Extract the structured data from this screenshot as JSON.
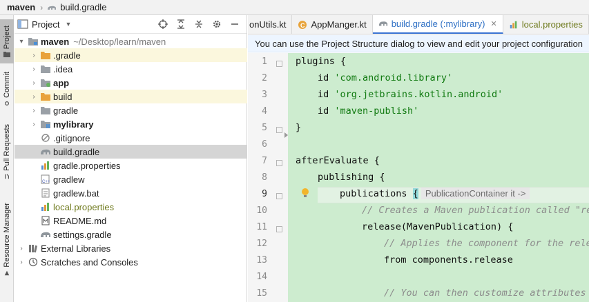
{
  "breadcrumb": {
    "root": "maven",
    "file": "build.gradle"
  },
  "tool_strip": {
    "project": "Project",
    "commit": "Commit",
    "pull_requests": "Pull Requests",
    "resource_manager": "Resource Manager"
  },
  "project_panel": {
    "title": "Project",
    "tree": [
      {
        "label": "maven",
        "path": "~/Desktop/learn/maven"
      },
      {
        "label": ".gradle"
      },
      {
        "label": ".idea"
      },
      {
        "label": "app"
      },
      {
        "label": "build"
      },
      {
        "label": "gradle"
      },
      {
        "label": "mylibrary"
      },
      {
        "label": ".gitignore"
      },
      {
        "label": "build.gradle"
      },
      {
        "label": "gradle.properties"
      },
      {
        "label": "gradlew"
      },
      {
        "label": "gradlew.bat"
      },
      {
        "label": "local.properties"
      },
      {
        "label": "README.md"
      },
      {
        "label": "settings.gradle"
      },
      {
        "label": "External Libraries"
      },
      {
        "label": "Scratches and Consoles"
      }
    ]
  },
  "tabs": [
    {
      "label": "onUtils.kt"
    },
    {
      "label": "AppManger.kt"
    },
    {
      "label": "build.gradle (:mylibrary)"
    },
    {
      "label": "local.properties"
    }
  ],
  "banner": "You can use the Project Structure dialog to view and edit your project configuration",
  "editor": {
    "line_numbers": [
      "1",
      "2",
      "3",
      "4",
      "5",
      "6",
      "7",
      "8",
      "9",
      "10",
      "11",
      "12",
      "13",
      "14",
      "15"
    ],
    "lines": {
      "l1": "plugins {",
      "l2_kw": "id ",
      "l2_str": "'com.android.library'",
      "l3_kw": "id ",
      "l3_str": "'org.jetbrains.kotlin.android'",
      "l4_kw": "id ",
      "l4_str": "'maven-publish'",
      "l5": "}",
      "l7": "afterEvaluate {",
      "l8": "publishing {",
      "l9_code": "publications ",
      "l9_brace": "{",
      "l9_hint": "PublicationContainer it ->",
      "l10": "// Creates a Maven publication called \"re",
      "l11": "release(MavenPublication) {",
      "l12": "// Applies the component for the rele",
      "l13": "from components.release",
      "l15": "// You can then customize attributes"
    }
  },
  "colors": {
    "accent": "#3b74d4",
    "editor_bg": "#cdeccf",
    "banner_bg": "#edf5ff",
    "string": "#117a11"
  }
}
